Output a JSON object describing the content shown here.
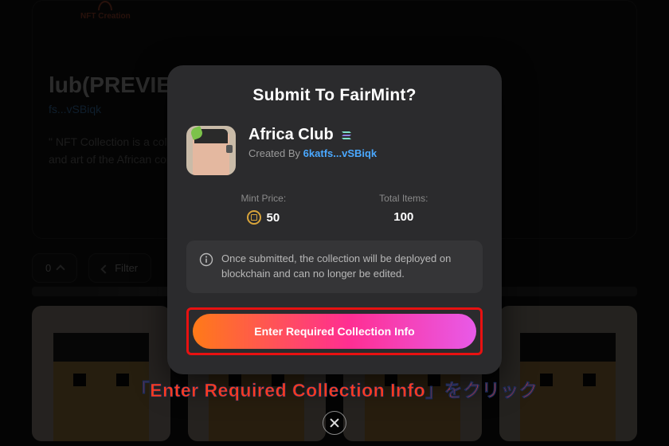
{
  "bg": {
    "logo_text": "NFT Creation",
    "title_fragment": "lub(PREVIEW",
    "address_fragment": "fs...vSBiqk",
    "desc_line1": "\" NFT Collection is a coll",
    "desc_line2": "and art of the African con",
    "pill_0": "0",
    "filter_label": "Filter"
  },
  "modal": {
    "title": "Submit To FairMint?",
    "collection_name": "Africa Club",
    "created_by_label": "Created By",
    "creator": "6katfs...vSBiqk",
    "mint_price_label": "Mint Price:",
    "mint_price_value": "50",
    "total_items_label": "Total Items:",
    "total_items_value": "100",
    "info_text": "Once submitted, the collection will be deployed on blockchain and can no longer be edited.",
    "cta_label": "Enter Required Collection Info"
  },
  "annotation": "「Enter Required Collection Info」をクリック"
}
